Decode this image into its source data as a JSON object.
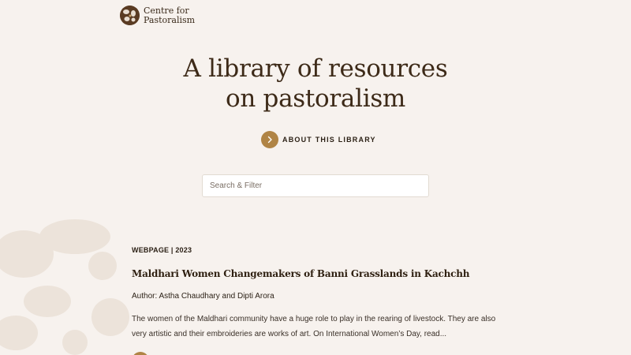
{
  "brand": {
    "name_line1": "Centre for",
    "name_line2": "Pastoralism"
  },
  "hero": {
    "title_line1": "A library of resources",
    "title_line2": "on pastoralism",
    "about_label": "ABOUT THIS LIBRARY"
  },
  "search": {
    "placeholder": "Search & Filter",
    "value": ""
  },
  "results": [
    {
      "meta": "WEBPAGE | 2023",
      "title": "Maldhari Women Changemakers of Banni Grasslands in Kachchh",
      "author": "Author: Astha Chaudhary and Dipti Arora",
      "description": "The women of the Maldhari community have a huge role to play in the rearing of livestock. They are also very artistic and their embroideries are works of art. On International Women’s Day, read..."
    }
  ],
  "colors": {
    "background": "#f7f2ee",
    "accent": "#b08445",
    "heading": "#3d2a18"
  },
  "icons": {
    "about": "chevron-right-icon",
    "logo": "centre-for-pastoralism-logo"
  }
}
